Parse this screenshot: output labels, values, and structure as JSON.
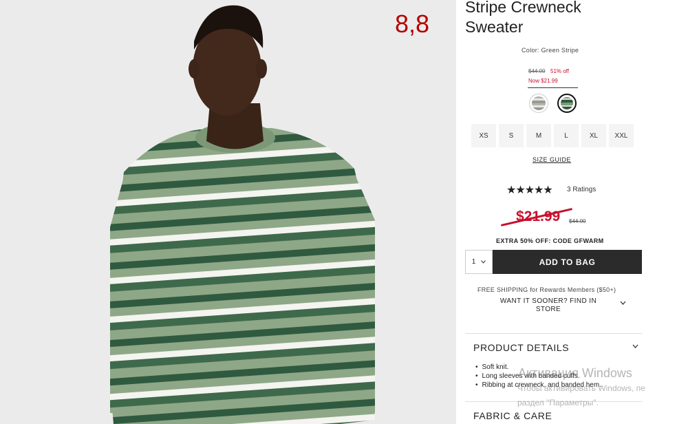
{
  "product": {
    "title_line1": "Stripe Crewneck",
    "title_line2": "Sweater",
    "color_label": "Color: Green Stripe",
    "old_price_small": "$44.00",
    "discount_small": "51% off",
    "now_price_small": "Now $21.99",
    "swatches": [
      "grey-stripe",
      "green-stripe"
    ],
    "sizes": [
      "XS",
      "S",
      "M",
      "L",
      "XL",
      "XXL"
    ],
    "size_guide": "SIZE GUIDE",
    "stars": "★★★★★",
    "ratings": "3 Ratings",
    "big_price": "$21.99",
    "big_old_price": "$44.00",
    "promo": "EXTRA 50% OFF: CODE GFWARM",
    "quantity": "1",
    "add_to_bag": "ADD TO BAG",
    "shipping": "FREE SHIPPING for Rewards Members ($50+)",
    "find_store": "WANT IT SOONER? FIND IN STORE",
    "product_details_title": "PRODUCT DETAILS",
    "details": [
      "Soft knit.",
      "Long sleeves with banded cuffs.",
      "Ribbing at crewneck, and banded hem."
    ],
    "fabric_care_title": "FABRIC & CARE"
  },
  "overlay": {
    "number": "8,8"
  },
  "watermark": {
    "line1": "Активация Windows",
    "line2": "Чтобы активировать Windows, пе",
    "line3": "раздел \"Параметры\"."
  },
  "colors": {
    "accent_red": "#c8102e",
    "button_dark": "#2b2b2b",
    "sweater_green": "#5d7a5a"
  },
  "icons": {
    "qty_chevron": "chevron-down-icon",
    "find_chevron": "chevron-down-icon",
    "details_chevron": "chevron-down-icon"
  }
}
